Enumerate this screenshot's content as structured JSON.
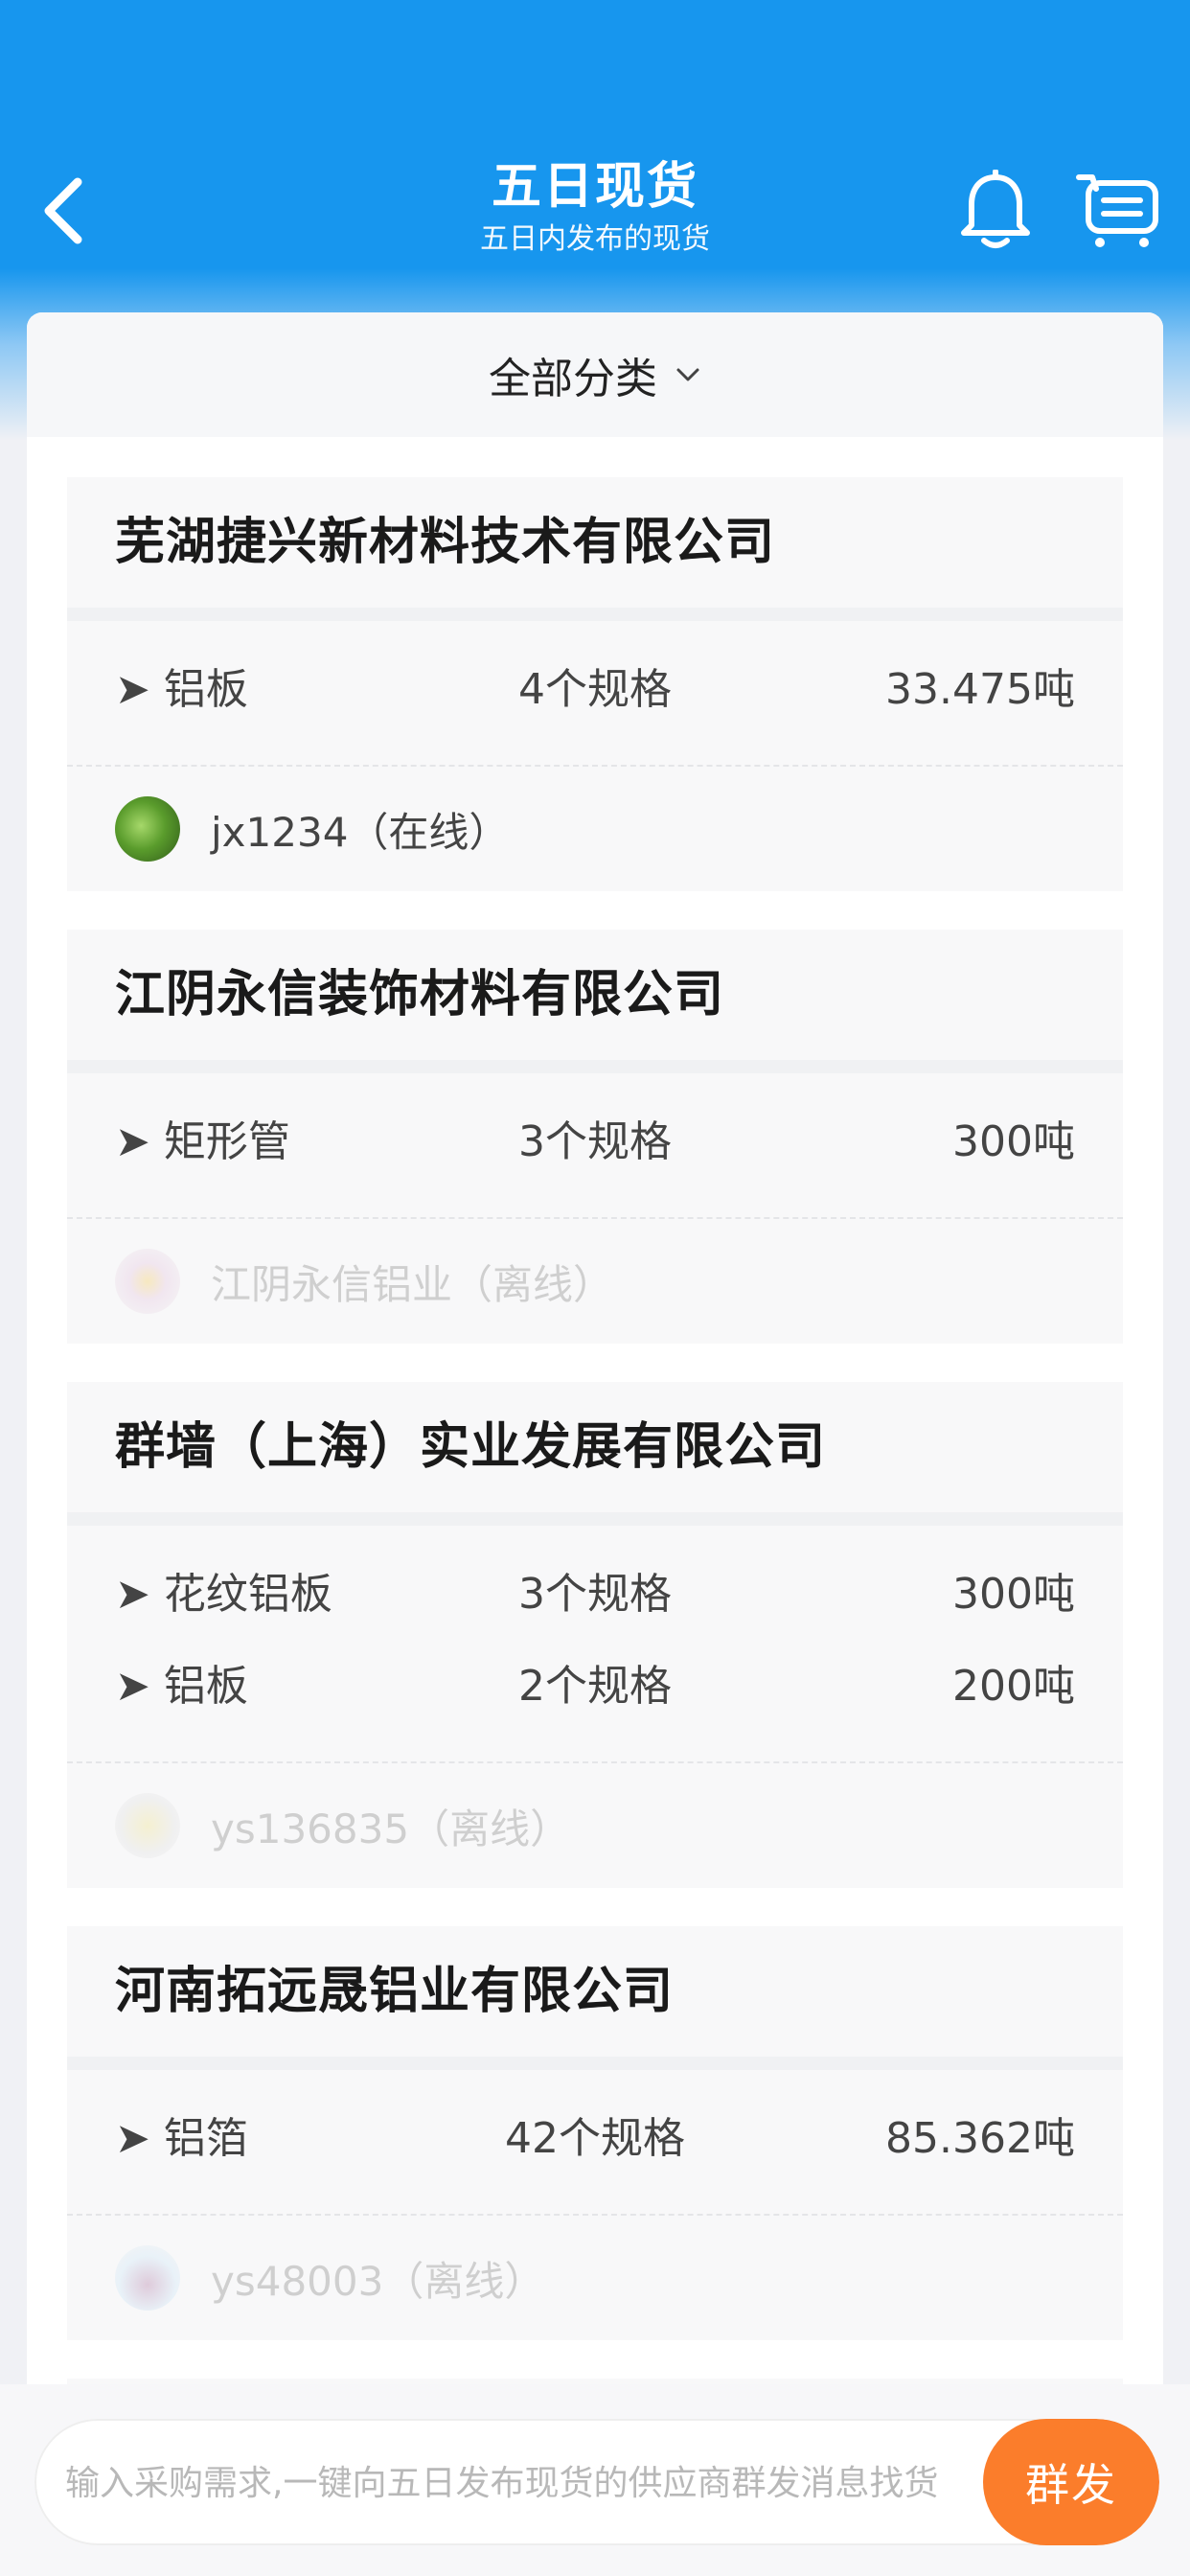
{
  "header": {
    "title": "五日现货",
    "subtitle": "五日内发布的现货"
  },
  "icons": {
    "back": "chevron-left-icon",
    "notifications": "bell-icon",
    "purchase_list": "cart-list-icon"
  },
  "colors": {
    "header_blue": "#1796ee",
    "send_orange": "#fb7d2b"
  },
  "filter": {
    "label": "全部分类"
  },
  "companies": [
    {
      "name": "芜湖捷兴新材料技术有限公司",
      "products": [
        {
          "name": "➤ 铝板",
          "specs": "4个规格",
          "weight": "33.475吨"
        }
      ],
      "seller": "jx1234（在线）",
      "online": true
    },
    {
      "name": "江阴永信装饰材料有限公司",
      "products": [
        {
          "name": "➤ 矩形管",
          "specs": "3个规格",
          "weight": "300吨"
        }
      ],
      "seller": "江阴永信铝业（离线）",
      "online": false
    },
    {
      "name": "群墙（上海）实业发展有限公司",
      "products": [
        {
          "name": "➤ 花纹铝板",
          "specs": "3个规格",
          "weight": "300吨"
        },
        {
          "name": "➤ 铝板",
          "specs": "2个规格",
          "weight": "200吨"
        }
      ],
      "seller": "ys136835（离线）",
      "online": false
    },
    {
      "name": "河南拓远晟铝业有限公司",
      "products": [
        {
          "name": "➤ 铝箔",
          "specs": "42个规格",
          "weight": "85.362吨"
        }
      ],
      "seller": "ys48003（离线）",
      "online": false
    }
  ],
  "bottom": {
    "placeholder": "输入采购需求,一键向五日发布现货的供应商群发消息找货",
    "send_label": "群发"
  }
}
